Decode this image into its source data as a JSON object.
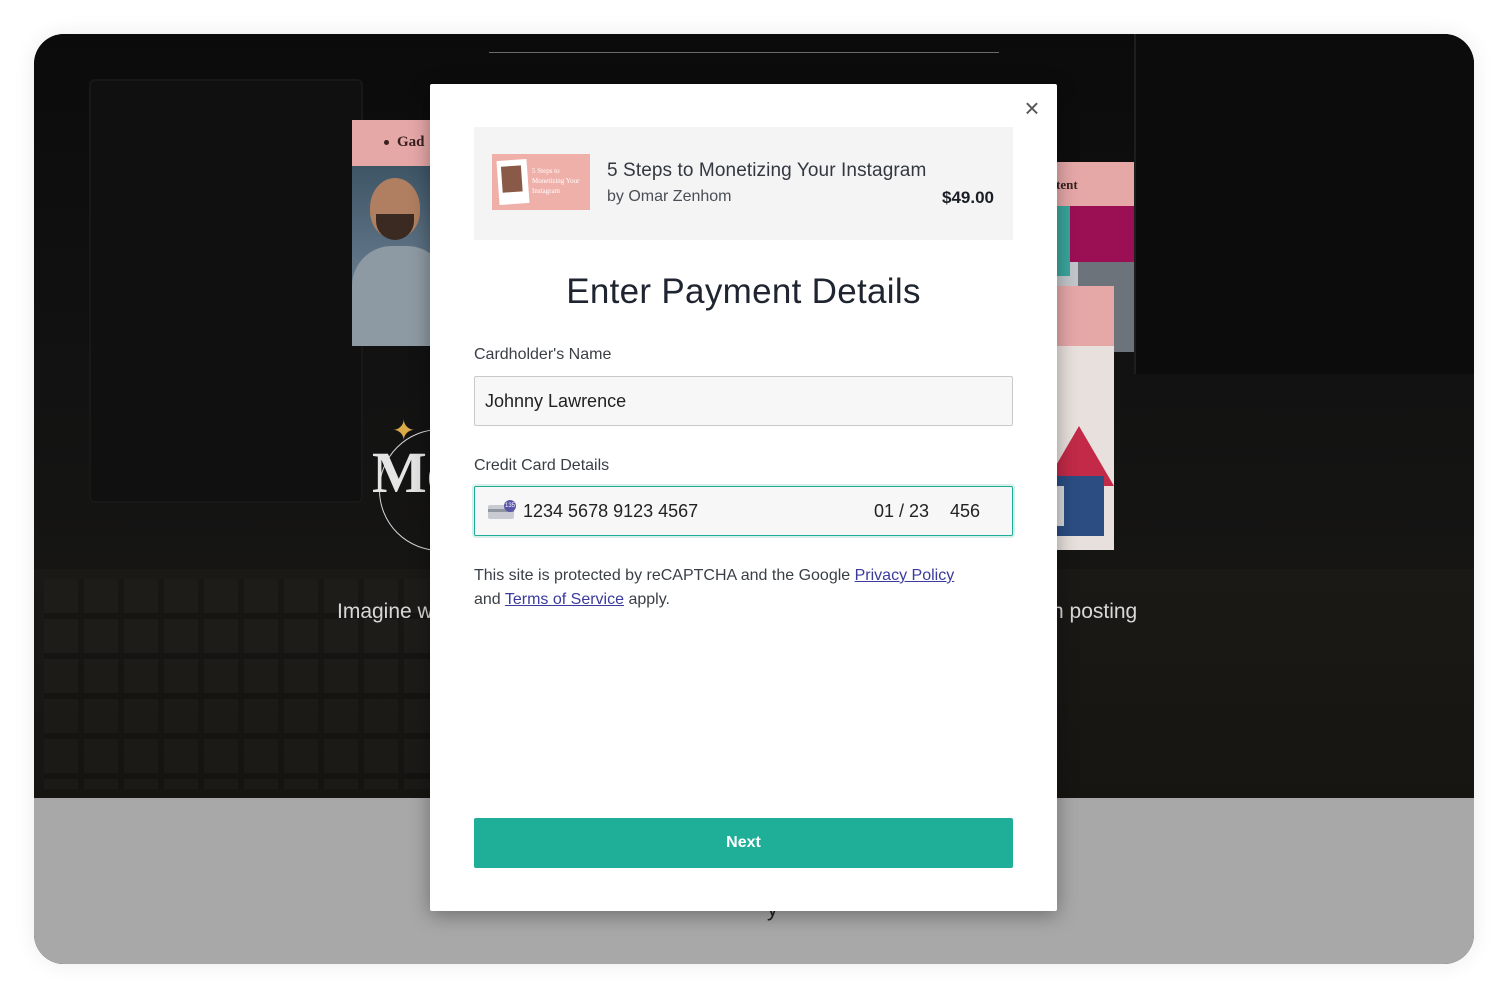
{
  "background": {
    "left_card_heading": "Gad",
    "right_card_heading": "tent",
    "logo_text": "Mo",
    "left_caption": "Imagine w",
    "right_caption": "n posting",
    "lower_glyph": "y"
  },
  "modal": {
    "close_icon": "×",
    "product": {
      "thumbnail_text": "5 Steps to Monetizing Your Instagram",
      "title": "5 Steps to Monetizing Your Instagram",
      "author": "by Omar Zenhom",
      "price": "$49.00"
    },
    "heading": "Enter Payment Details",
    "cardholder": {
      "label": "Cardholder's Name",
      "value": "Johnny Lawrence"
    },
    "credit_card": {
      "label": "Credit Card Details",
      "number": "1234 5678 9123 4567",
      "expiry": "01 / 23",
      "cvc": "456",
      "icon": "card-icon"
    },
    "legal": {
      "prefix": "This site is protected by reCAPTCHA and the Google ",
      "privacy_link": "Privacy Policy",
      "middle": "and ",
      "terms_link": "Terms of Service",
      "suffix": " apply."
    },
    "next_button": "Next"
  },
  "colors": {
    "accent": "#1fae98",
    "link": "#3b3b9c",
    "heading": "#1e2430"
  }
}
